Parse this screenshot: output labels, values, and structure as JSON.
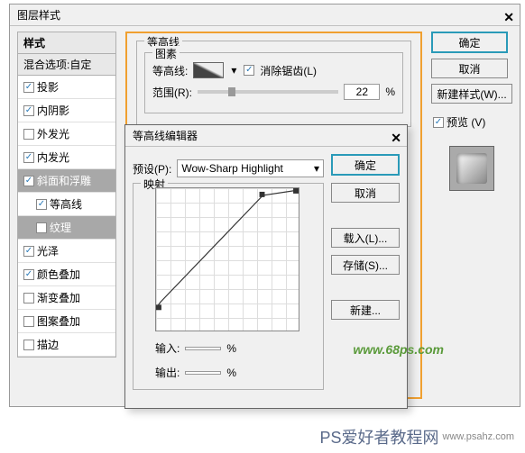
{
  "main_dialog": {
    "title": "图层样式",
    "styles_header": "样式",
    "blend_header": "混合选项:自定",
    "items": [
      {
        "label": "投影",
        "checked": true,
        "sub": false,
        "sel": false
      },
      {
        "label": "内阴影",
        "checked": true,
        "sub": false,
        "sel": false
      },
      {
        "label": "外发光",
        "checked": false,
        "sub": false,
        "sel": false
      },
      {
        "label": "内发光",
        "checked": true,
        "sub": false,
        "sel": false
      },
      {
        "label": "斜面和浮雕",
        "checked": true,
        "sub": false,
        "sel": true
      },
      {
        "label": "等高线",
        "checked": true,
        "sub": true,
        "sel": false
      },
      {
        "label": "纹理",
        "checked": false,
        "sub": true,
        "sel": true
      },
      {
        "label": "光泽",
        "checked": true,
        "sub": false,
        "sel": false
      },
      {
        "label": "颜色叠加",
        "checked": true,
        "sub": false,
        "sel": false
      },
      {
        "label": "渐变叠加",
        "checked": false,
        "sub": false,
        "sel": false
      },
      {
        "label": "图案叠加",
        "checked": false,
        "sub": false,
        "sel": false
      },
      {
        "label": "描边",
        "checked": false,
        "sub": false,
        "sel": false
      }
    ],
    "contour_group": "等高线",
    "pattern_group": "图素",
    "contour_label": "等高线:",
    "antialias_label": "消除锯齿(L)",
    "range_label": "范围(R):",
    "range_value": "22",
    "pct": "%",
    "buttons": {
      "ok": "确定",
      "cancel": "取消",
      "new_style": "新建样式(W)...",
      "preview": "预览 (V)"
    }
  },
  "editor": {
    "title": "等高线编辑器",
    "preset_label": "预设(P):",
    "preset_value": "Wow-Sharp Highlight",
    "mapping_label": "映射",
    "input_label": "输入:",
    "output_label": "输出:",
    "pct": "%",
    "buttons": {
      "ok": "确定",
      "cancel": "取消",
      "load": "载入(L)...",
      "save": "存储(S)...",
      "new": "新建..."
    }
  },
  "watermark": "www.68ps.com",
  "footer": {
    "txt": "PS爱好者教程网",
    "url": "www.psahz.com"
  }
}
